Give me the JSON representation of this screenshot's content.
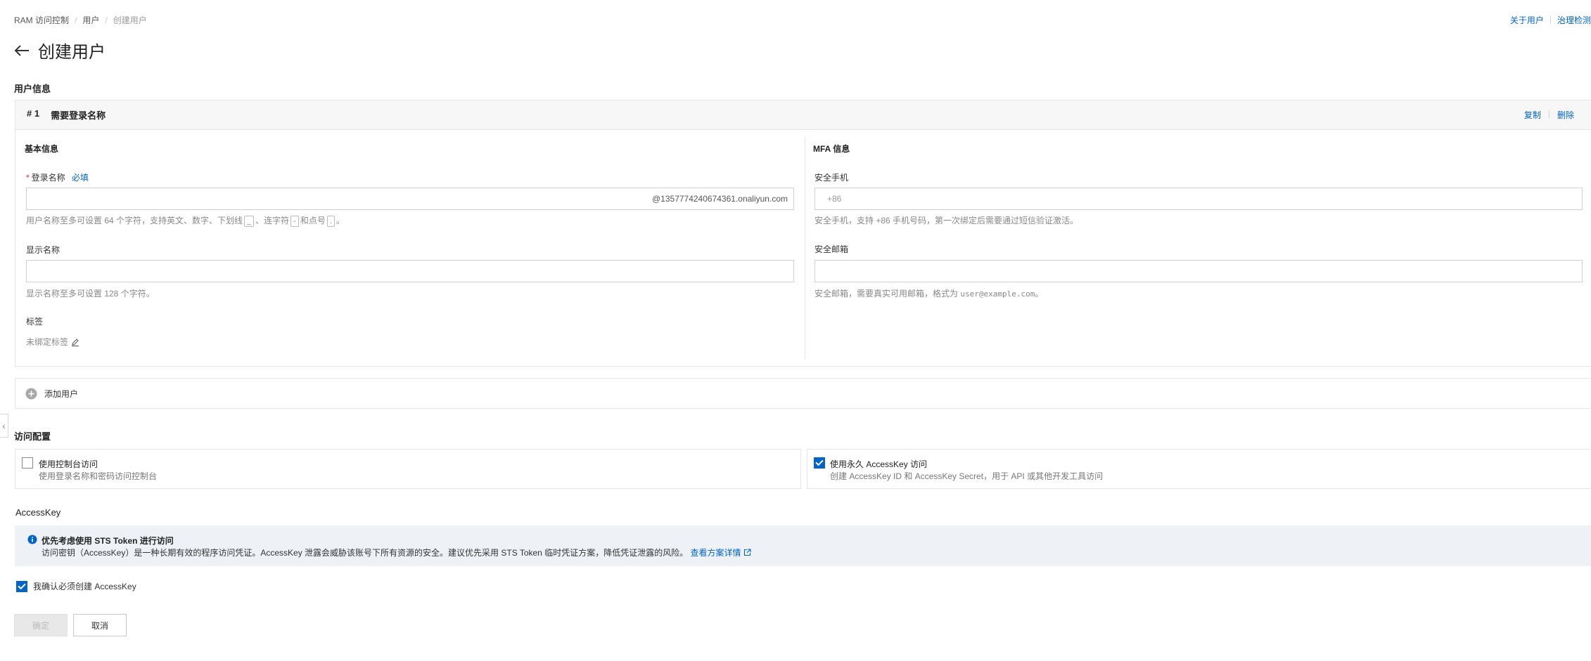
{
  "breadcrumb": {
    "items": [
      "RAM 访问控制",
      "用户",
      "创建用户"
    ]
  },
  "top_links": {
    "about": "关于用户",
    "governance": "治理检测"
  },
  "page": {
    "title": "创建用户"
  },
  "user_info": {
    "section_title": "用户信息",
    "card": {
      "index": "# 1",
      "heading": "需要登录名称",
      "copy": "复制",
      "delete": "删除"
    },
    "basic": {
      "title": "基本信息",
      "login_label": "登录名称",
      "login_required": "必填",
      "login_value": "",
      "login_suffix": "@1357774240674361.onaliyun.com",
      "login_help_prefix": "用户名称至多可设置 64 个字符，支持英文、数字、下划线",
      "login_help_k1": "_",
      "login_help_mid1": "、连字符",
      "login_help_k2": "-",
      "login_help_mid2": "和点号",
      "login_help_k3": ".",
      "login_help_end": "。",
      "display_label": "显示名称",
      "display_value": "",
      "display_help": "显示名称至多可设置 128 个字符。",
      "tags_label": "标签",
      "tags_value": "未绑定标签"
    },
    "mfa": {
      "title": "MFA 信息",
      "phone_label": "安全手机",
      "phone_placeholder": "+86",
      "phone_help": "安全手机，支持 +86 手机号码，第一次绑定后需要通过短信验证激活。",
      "email_label": "安全邮箱",
      "email_value": "",
      "email_help_prefix": "安全邮箱，需要真实可用邮箱，格式为",
      "email_help_example": "user@example.com",
      "email_help_end": "。"
    },
    "add_user": "添加用户"
  },
  "access": {
    "section_title": "访问配置",
    "console": {
      "title": "使用控制台访问",
      "desc": "使用登录名称和密码访问控制台",
      "checked": false
    },
    "accesskey": {
      "title": "使用永久 AccessKey 访问",
      "desc": "创建 AccessKey ID 和 AccessKey Secret，用于 API 或其他开发工具访问",
      "checked": true
    }
  },
  "accesskey_section": {
    "title": "AccessKey",
    "notice_title": "优先考虑使用 STS Token 进行访问",
    "notice_body": "访问密钥（AccessKey）是一种长期有效的程序访问凭证。AccessKey 泄露会威胁该账号下所有资源的安全。建议优先采用 STS Token 临时凭证方案，降低凭证泄露的风险。",
    "notice_link": "查看方案详情",
    "confirm_label": "我确认必须创建 AccessKey",
    "confirm_checked": true
  },
  "actions": {
    "ok": "确定",
    "cancel": "取消"
  },
  "colors": {
    "accent": "#0064c8",
    "notice_bg": "#eef2f7"
  }
}
